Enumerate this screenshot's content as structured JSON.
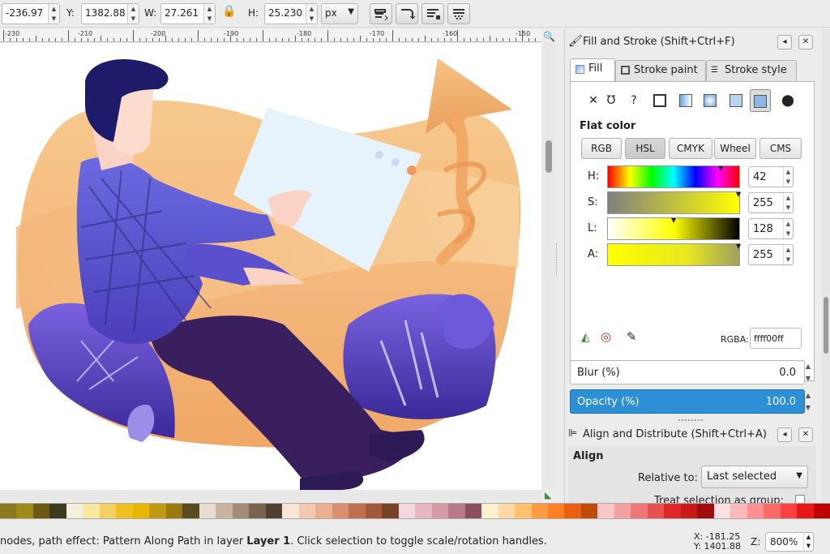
{
  "toolbar": {
    "x_value": "-236.97",
    "y_label": "Y:",
    "y_value": "1382.88",
    "w_label": "W:",
    "w_value": "27.261",
    "h_label": "H:",
    "h_value": "25.230",
    "unit": "px"
  },
  "ruler": {
    "labels": [
      "-230",
      "-210",
      "-200",
      "-190",
      "-180",
      "-170",
      "-160",
      "-150"
    ]
  },
  "fill_stroke": {
    "title": "Fill and Stroke (Shift+Ctrl+F)",
    "tabs": [
      "Fill",
      "Stroke paint",
      "Stroke style"
    ],
    "fill_type": "Flat color",
    "modes": [
      "RGB",
      "HSL",
      "CMYK",
      "Wheel",
      "CMS"
    ],
    "active_mode": "HSL",
    "channels": [
      {
        "label": "H:",
        "value": "42"
      },
      {
        "label": "S:",
        "value": "255"
      },
      {
        "label": "L:",
        "value": "128"
      },
      {
        "label": "A:",
        "value": "255"
      }
    ],
    "rgba_label": "RGBA:",
    "rgba_value": "ffff00ff",
    "blur_label": "Blur (%)",
    "blur_value": "0.0",
    "opacity_label": "Opacity (%)",
    "opacity_value": "100.0"
  },
  "align": {
    "title": "Align and Distribute (Shift+Ctrl+A)",
    "section": "Align",
    "relative_label": "Relative to:",
    "relative_value": "Last selected",
    "treat_label": "Treat selection as group:"
  },
  "status": {
    "text_pre": "nodes, path effect: Pattern Along Path in layer ",
    "layer": "Layer 1",
    "text_post": ". Click selection to toggle scale/rotation handles.",
    "x_coord": "X: -181.25",
    "y_coord": "Y: 1401.88",
    "zoom_label": "Z:",
    "zoom_value": "800%"
  },
  "palette_colors": [
    "#8a7a20",
    "#a08a1a",
    "#6b5a10",
    "#3d3a20",
    "#f4f0e0",
    "#f8e8a0",
    "#f4d060",
    "#f0c020",
    "#e8b800",
    "#c09a10",
    "#9a7a10",
    "#5a4a20",
    "#e8ddd0",
    "#c8b4a0",
    "#a08c78",
    "#78644f",
    "#504030",
    "#f8e4d8",
    "#f4c8b0",
    "#eab090",
    "#d89070",
    "#c07050",
    "#a05a3a",
    "#7a4028",
    "#f4d8e0",
    "#e8b8c0",
    "#d49aa8",
    "#b87a88",
    "#8a5060",
    "#fff0d0",
    "#ffd8a0",
    "#ffc070",
    "#ff9a40",
    "#ff8020",
    "#e86010",
    "#c04a08",
    "#f8c8c8",
    "#f4a0a0",
    "#ee7878",
    "#e85050",
    "#e02828",
    "#c81818",
    "#a00c0c",
    "#ffe0e0",
    "#ffb8b8",
    "#ff9090",
    "#ff6868",
    "#ff4040",
    "#e81818",
    "#c00000"
  ]
}
